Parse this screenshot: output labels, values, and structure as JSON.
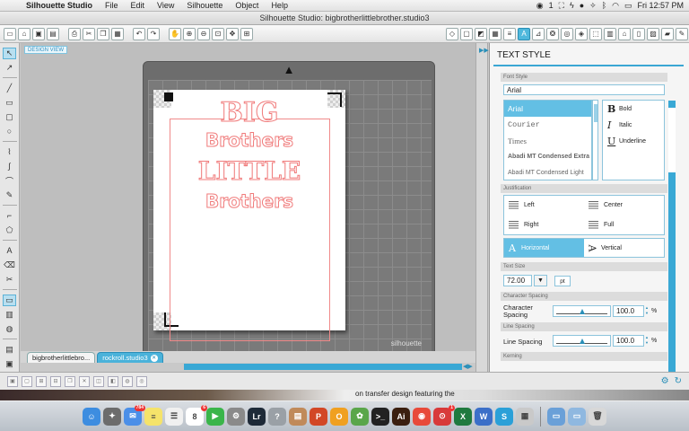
{
  "menubar": {
    "apple_glyph": "",
    "items": [
      "Silhouette Studio",
      "File",
      "Edit",
      "View",
      "Silhouette",
      "Object",
      "Help"
    ],
    "status_icons": [
      "camera-icon",
      "1",
      "mail-icon",
      "bolt-icon",
      "chat-icon",
      "dropbox-icon",
      "bluetooth-icon",
      "wifi-icon",
      "battery-icon"
    ],
    "badge_count": "1",
    "clock": "Fri 12:57 PM"
  },
  "window": {
    "title": "Silhouette Studio: bigbrotherlittlebrother.studio3"
  },
  "toolbar": {
    "left_icons": [
      "new-icon",
      "open-icon",
      "save-icon",
      "save-as-icon",
      "print-icon",
      "cut-icon",
      "copy-icon",
      "paste-icon",
      "undo-icon",
      "redo-icon",
      "pan-icon",
      "zoom-in-icon",
      "zoom-out-icon",
      "zoom-box-icon",
      "move-icon",
      "fit-icon"
    ],
    "right_icons": [
      "fill-icon",
      "line-icon",
      "gradient-icon",
      "pattern-icon",
      "line-style-icon",
      "text-style-icon",
      "transform-icon",
      "replicate-icon",
      "modify-icon",
      "offset-icon",
      "trace-icon",
      "library-icon",
      "store-icon",
      "page-setup-icon",
      "registration-icon",
      "send-icon",
      "cut-settings-icon"
    ]
  },
  "lefttools": [
    "select-icon",
    "edit-points-icon",
    "line-icon",
    "rectangle-icon",
    "rounded-rect-icon",
    "ellipse-icon",
    "polygon-icon",
    "curve-icon",
    "arc-icon",
    "freehand-icon",
    "pencil-icon",
    "knife-icon",
    "text-icon",
    "eraser-icon",
    "knife-tool-icon",
    "grid-view-icon",
    "library-icon",
    "store-icon",
    "layers-icon",
    "page-icon"
  ],
  "canvas": {
    "design_view_label": "DESIGN VIEW",
    "mat_brand": "silhouette",
    "design_lines": [
      "BIG",
      "Brothers",
      "LITTLE",
      "Brothers"
    ]
  },
  "doctabs": [
    {
      "label": "bigbrotherlittlebro...",
      "active": false
    },
    {
      "label": "rockroll.studio3",
      "active": true
    }
  ],
  "panel": {
    "title": "TEXT STYLE",
    "font_style_label": "Font Style",
    "font_value": "Arial",
    "fonts": [
      "Arial",
      "Courier",
      "Times",
      "Abadi MT Condensed Extra",
      "Abadi MT Condensed Light"
    ],
    "styles": [
      {
        "glyph": "B",
        "label": "Bold"
      },
      {
        "glyph": "I",
        "label": "Italic"
      },
      {
        "glyph": "U",
        "label": "Underline"
      }
    ],
    "justification_label": "Justification",
    "justify": [
      "Left",
      "Center",
      "Right",
      "Full"
    ],
    "orientation": [
      {
        "glyph": "A",
        "label": "Horizontal",
        "selected": true
      },
      {
        "glyph": "A",
        "label": "Vertical",
        "selected": false
      }
    ],
    "text_size_label": "Text Size",
    "text_size_value": "72.00",
    "text_size_unit": "pt",
    "char_spacing_section": "Character Spacing",
    "char_spacing_label_1": "Character",
    "char_spacing_label_2": "Spacing",
    "char_spacing_value": "100.0",
    "line_spacing_section": "Line Spacing",
    "line_spacing_label": "Line Spacing",
    "line_spacing_value": "100.0",
    "percent": "%",
    "kerning_label": "Kerning"
  },
  "desktop": {
    "caption": "on transfer design featuring the"
  },
  "dock": {
    "items": [
      {
        "name": "finder-icon",
        "color": "#3d8de0",
        "glyph": "☺"
      },
      {
        "name": "launchpad-icon",
        "color": "#6c6c6c",
        "glyph": "✦"
      },
      {
        "name": "mail-icon",
        "color": "#4b8fe8",
        "glyph": "✉",
        "badge": "784"
      },
      {
        "name": "notes-icon",
        "color": "#f5e36a",
        "glyph": "≡"
      },
      {
        "name": "reminders-icon",
        "color": "#f0f0f0",
        "glyph": "☰"
      },
      {
        "name": "calendar-icon",
        "color": "#ffffff",
        "glyph": "8",
        "badge": "6"
      },
      {
        "name": "facetime-icon",
        "color": "#3ab54a",
        "glyph": "▶"
      },
      {
        "name": "system-prefs-icon",
        "color": "#8a8a8a",
        "glyph": "⚙"
      },
      {
        "name": "lightroom-icon",
        "color": "#1e2a38",
        "glyph": "Lr"
      },
      {
        "name": "help-icon",
        "color": "#9aa0a6",
        "glyph": "?"
      },
      {
        "name": "preview-icon",
        "color": "#c08a5a",
        "glyph": "▤"
      },
      {
        "name": "powerpoint-icon",
        "color": "#d24726",
        "glyph": "P"
      },
      {
        "name": "onyx-icon",
        "color": "#f0a020",
        "glyph": "O"
      },
      {
        "name": "photo-icon",
        "color": "#5aa64a",
        "glyph": "✿"
      },
      {
        "name": "terminal-icon",
        "color": "#222222",
        "glyph": ">_"
      },
      {
        "name": "illustrator-icon",
        "color": "#3b1f0f",
        "glyph": "Ai"
      },
      {
        "name": "chrome-icon",
        "color": "#e84a3a",
        "glyph": "◉"
      },
      {
        "name": "pdf-icon",
        "color": "#d83a3a",
        "glyph": "⊙",
        "badge": "1"
      },
      {
        "name": "excel-icon",
        "color": "#1f7a3f",
        "glyph": "X"
      },
      {
        "name": "word-icon",
        "color": "#3b6fc8",
        "glyph": "W"
      },
      {
        "name": "silhouette-icon",
        "color": "#2aa0d8",
        "glyph": "S"
      },
      {
        "name": "screenshot-icon",
        "color": "#c9c9c9",
        "glyph": "▦"
      },
      {
        "name": "downloads-icon",
        "color": "#6aa0d8",
        "glyph": "▭"
      },
      {
        "name": "folder-icon",
        "color": "#8fb8e0",
        "glyph": "▭"
      },
      {
        "name": "trash-icon",
        "color": "#d8d8d8",
        "glyph": "🗑"
      }
    ]
  },
  "colors": {
    "accent": "#39a8d5",
    "cut_line": "#f08a8a"
  }
}
